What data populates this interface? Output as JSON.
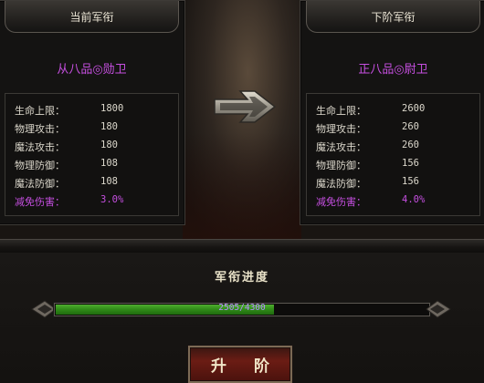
{
  "current": {
    "header": "当前军衔",
    "rank": "从八品◎勋卫",
    "stats": [
      {
        "label": "生命上限：",
        "value": "1800"
      },
      {
        "label": "物理攻击：",
        "value": "180"
      },
      {
        "label": "魔法攻击：",
        "value": "180"
      },
      {
        "label": "物理防御：",
        "value": "108"
      },
      {
        "label": "魔法防御：",
        "value": "108"
      },
      {
        "label": "减免伤害：",
        "value": "3.0%"
      }
    ]
  },
  "next": {
    "header": "下阶军衔",
    "rank": "正八品◎尉卫",
    "stats": [
      {
        "label": "生命上限：",
        "value": "2600"
      },
      {
        "label": "物理攻击：",
        "value": "260"
      },
      {
        "label": "魔法攻击：",
        "value": "260"
      },
      {
        "label": "物理防御：",
        "value": "156"
      },
      {
        "label": "魔法防御：",
        "value": "156"
      },
      {
        "label": "减免伤害：",
        "value": "4.0%"
      }
    ]
  },
  "progress": {
    "title": "军衔进度",
    "current": 2505,
    "max": 4300,
    "text": "2505/4300"
  },
  "upgrade_button": "升 阶",
  "colors": {
    "rank_text": "#c64fe0",
    "progress_fill": "#2f8a18",
    "button_red": "#6b1c14"
  }
}
